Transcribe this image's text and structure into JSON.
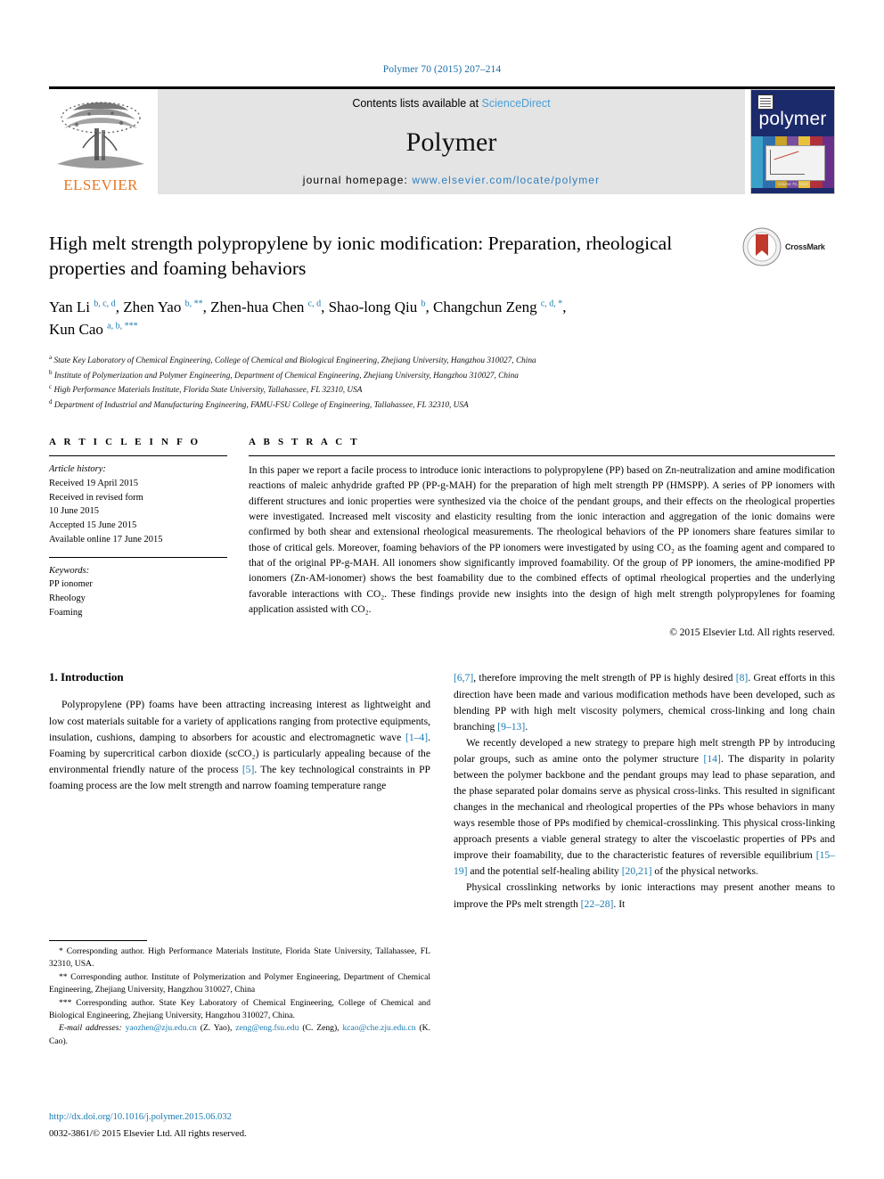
{
  "running_head": "Polymer 70 (2015) 207–214",
  "masthead": {
    "publisher_name": "ELSEVIER",
    "contents_prefix": "Contents lists available at ",
    "sciencedirect": "ScienceDirect",
    "journal_name": "Polymer",
    "homepage_prefix": "journal homepage: ",
    "homepage_url": "www.elsevier.com/locate/polymer",
    "cover_title": "polymer",
    "cover_footer": "Volume 70, 2015"
  },
  "article": {
    "title": "High melt strength polypropylene by ionic modification: Preparation, rheological properties and foaming behaviors",
    "crossmark_label": "CrossMark",
    "authors_line_1": "Yan Li ",
    "authors": [
      {
        "name": "Yan Li",
        "marks": "b, c, d"
      },
      {
        "name": "Zhen Yao",
        "marks": "b, **"
      },
      {
        "name": "Zhen-hua Chen",
        "marks": "c, d"
      },
      {
        "name": "Shao-long Qiu",
        "marks": "b"
      },
      {
        "name": "Changchun Zeng",
        "marks": "c, d, *"
      },
      {
        "name": "Kun Cao",
        "marks": "a, b, ***"
      }
    ],
    "affiliations": [
      {
        "mark": "a",
        "text": "State Key Laboratory of Chemical Engineering, College of Chemical and Biological Engineering, Zhejiang University, Hangzhou 310027, China"
      },
      {
        "mark": "b",
        "text": "Institute of Polymerization and Polymer Engineering, Department of Chemical Engineering, Zhejiang University, Hangzhou 310027, China"
      },
      {
        "mark": "c",
        "text": "High Performance Materials Institute, Florida State University, Tallahassee, FL 32310, USA"
      },
      {
        "mark": "d",
        "text": "Department of Industrial and Manufacturing Engineering, FAMU-FSU College of Engineering, Tallahassee, FL 32310, USA"
      }
    ]
  },
  "article_info": {
    "heading": "A R T I C L E  I N F O",
    "history_label": "Article history:",
    "history": [
      "Received 19 April 2015",
      "Received in revised form",
      "10 June 2015",
      "Accepted 15 June 2015",
      "Available online 17 June 2015"
    ],
    "keywords_label": "Keywords:",
    "keywords": [
      "PP ionomer",
      "Rheology",
      "Foaming"
    ]
  },
  "abstract": {
    "heading": "A B S T R A C T",
    "text": "In this paper we report a facile process to introduce ionic interactions to polypropylene (PP) based on Zn-neutralization and amine modification reactions of maleic anhydride grafted PP (PP-g-MAH) for the preparation of high melt strength PP (HMSPP). A series of PP ionomers with different structures and ionic properties were synthesized via the choice of the pendant groups, and their effects on the rheological properties were investigated. Increased melt viscosity and elasticity resulting from the ionic interaction and aggregation of the ionic domains were confirmed by both shear and extensional rheological measurements. The rheological behaviors of the PP ionomers share features similar to those of critical gels. Moreover, foaming behaviors of the PP ionomers were investigated by using CO₂ as the foaming agent and compared to that of the original PP-g-MAH. All ionomers show significantly improved foamability. Of the group of PP ionomers, the amine-modified PP ionomers (Zn-AM-ionomer) shows the best foamability due to the combined effects of optimal rheological properties and the underlying favorable interactions with CO₂. These findings provide new insights into the design of high melt strength polypropylenes for foaming application assisted with CO₂.",
    "copyright": "© 2015 Elsevier Ltd. All rights reserved."
  },
  "introduction": {
    "section_number_title": "1.  Introduction",
    "para1_a": "Polypropylene (PP) foams have been attracting increasing interest as lightweight and low cost materials suitable for a variety of applications ranging from protective equipments, insulation, cushions, damping to absorbers for acoustic and electromagnetic wave ",
    "ref_1_4": "[1–4]",
    "para1_b": ". Foaming by supercritical carbon dioxide (scCO₂) is particularly appealing because of the environmental friendly nature of the process ",
    "ref_5": "[5]",
    "para1_c": ". The key technological constraints in PP foaming process are the low melt strength and narrow foaming temperature range ",
    "ref_6_7": "[6,7]",
    "para1_d": ", therefore improving the melt strength of PP is highly desired ",
    "ref_8": "[8]",
    "para1_e": ". Great efforts in this direction have been made and various modification methods have been developed, such as blending PP with high melt viscosity polymers, chemical cross-linking and long chain branching ",
    "ref_9_13": "[9–13]",
    "para1_f": ".",
    "para2_a": "We recently developed a new strategy to prepare high melt strength PP by introducing polar groups, such as amine onto the polymer structure ",
    "ref_14": "[14]",
    "para2_b": ". The disparity in polarity between the polymer backbone and the pendant groups may lead to phase separation, and the phase separated polar domains serve as physical cross-links. This resulted in significant changes in the mechanical and rheological properties of the PPs whose behaviors in many ways resemble those of PPs modified by chemical-crosslinking. This physical cross-linking approach presents a viable general strategy to alter the viscoelastic properties of PPs and improve their foamability, due to the characteristic features of reversible equilibrium ",
    "ref_15_19": "[15–19]",
    "para2_c": " and the potential self-healing ability ",
    "ref_20_21": "[20,21]",
    "para2_d": " of the physical networks.",
    "para3_a": "Physical crosslinking networks by ionic interactions may present another means to improve the PPs melt strength ",
    "ref_22_28": "[22–28]",
    "para3_b": ". It"
  },
  "footnotes": {
    "note1": "* Corresponding author. High Performance Materials Institute, Florida State University, Tallahassee, FL 32310, USA.",
    "note2": "** Corresponding author. Institute of Polymerization and Polymer Engineering, Department of Chemical Engineering, Zhejiang University, Hangzhou 310027, China",
    "note3": "*** Corresponding author. State Key Laboratory of Chemical Engineering, College of Chemical and Biological Engineering, Zhejiang University, Hangzhou 310027, China.",
    "email_label": "E-mail addresses:",
    "email1": "yaozhen@zju.edu.cn",
    "email1_owner": " (Z. Yao), ",
    "email2": "zeng@eng.fsu.edu",
    "email2_owner": " (C. Zeng), ",
    "email3": "kcao@che.zju.edu.cn",
    "email3_owner": " (K. Cao)."
  },
  "footer": {
    "doi": "http://dx.doi.org/10.1016/j.polymer.2015.06.032",
    "issn": "0032-3861/© 2015 Elsevier Ltd. All rights reserved."
  },
  "colors": {
    "link_blue": "#1a7ab0",
    "sciencedirect_blue": "#4a9fd4",
    "elsevier_orange": "#E87722",
    "cover_navy": "#1b2a6b",
    "banner_gray": "#e4e4e4"
  }
}
